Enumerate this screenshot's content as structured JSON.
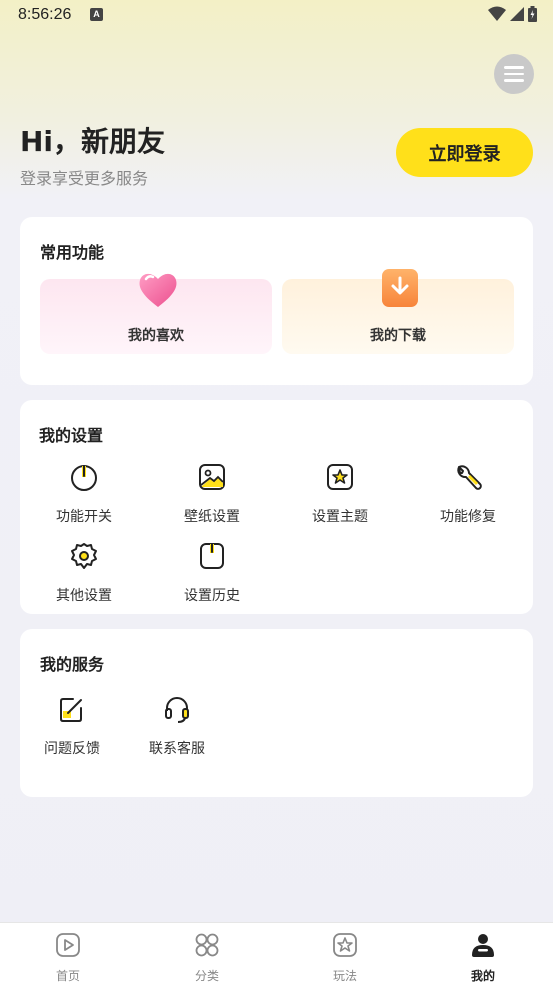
{
  "status_bar": {
    "time": "8:56:26",
    "a_badge": "A"
  },
  "header": {
    "greeting": "Hi，新朋友",
    "subtitle": "登录享受更多服务",
    "login_label": "立即登录"
  },
  "common": {
    "title": "常用功能",
    "items": [
      {
        "label": "我的喜欢",
        "icon": "heart-icon"
      },
      {
        "label": "我的下载",
        "icon": "download-icon"
      }
    ]
  },
  "settings": {
    "title": "我的设置",
    "items": [
      {
        "label": "功能开关",
        "icon": "power-icon"
      },
      {
        "label": "壁纸设置",
        "icon": "image-icon"
      },
      {
        "label": "设置主题",
        "icon": "theme-icon"
      },
      {
        "label": "功能修复",
        "icon": "wrench-icon"
      },
      {
        "label": "其他设置",
        "icon": "gear-icon"
      },
      {
        "label": "设置历史",
        "icon": "history-icon"
      }
    ]
  },
  "services": {
    "title": "我的服务",
    "items": [
      {
        "label": "问题反馈",
        "icon": "feedback-icon"
      },
      {
        "label": "联系客服",
        "icon": "headset-icon"
      }
    ]
  },
  "tabbar": {
    "tabs": [
      {
        "label": "首页",
        "icon": "play-icon"
      },
      {
        "label": "分类",
        "icon": "grid-icon"
      },
      {
        "label": "玩法",
        "icon": "sparkle-icon"
      },
      {
        "label": "我的",
        "icon": "user-icon",
        "active": true
      }
    ]
  },
  "colors": {
    "accent": "#ffe01a",
    "accent_dark": "#f5c400"
  }
}
